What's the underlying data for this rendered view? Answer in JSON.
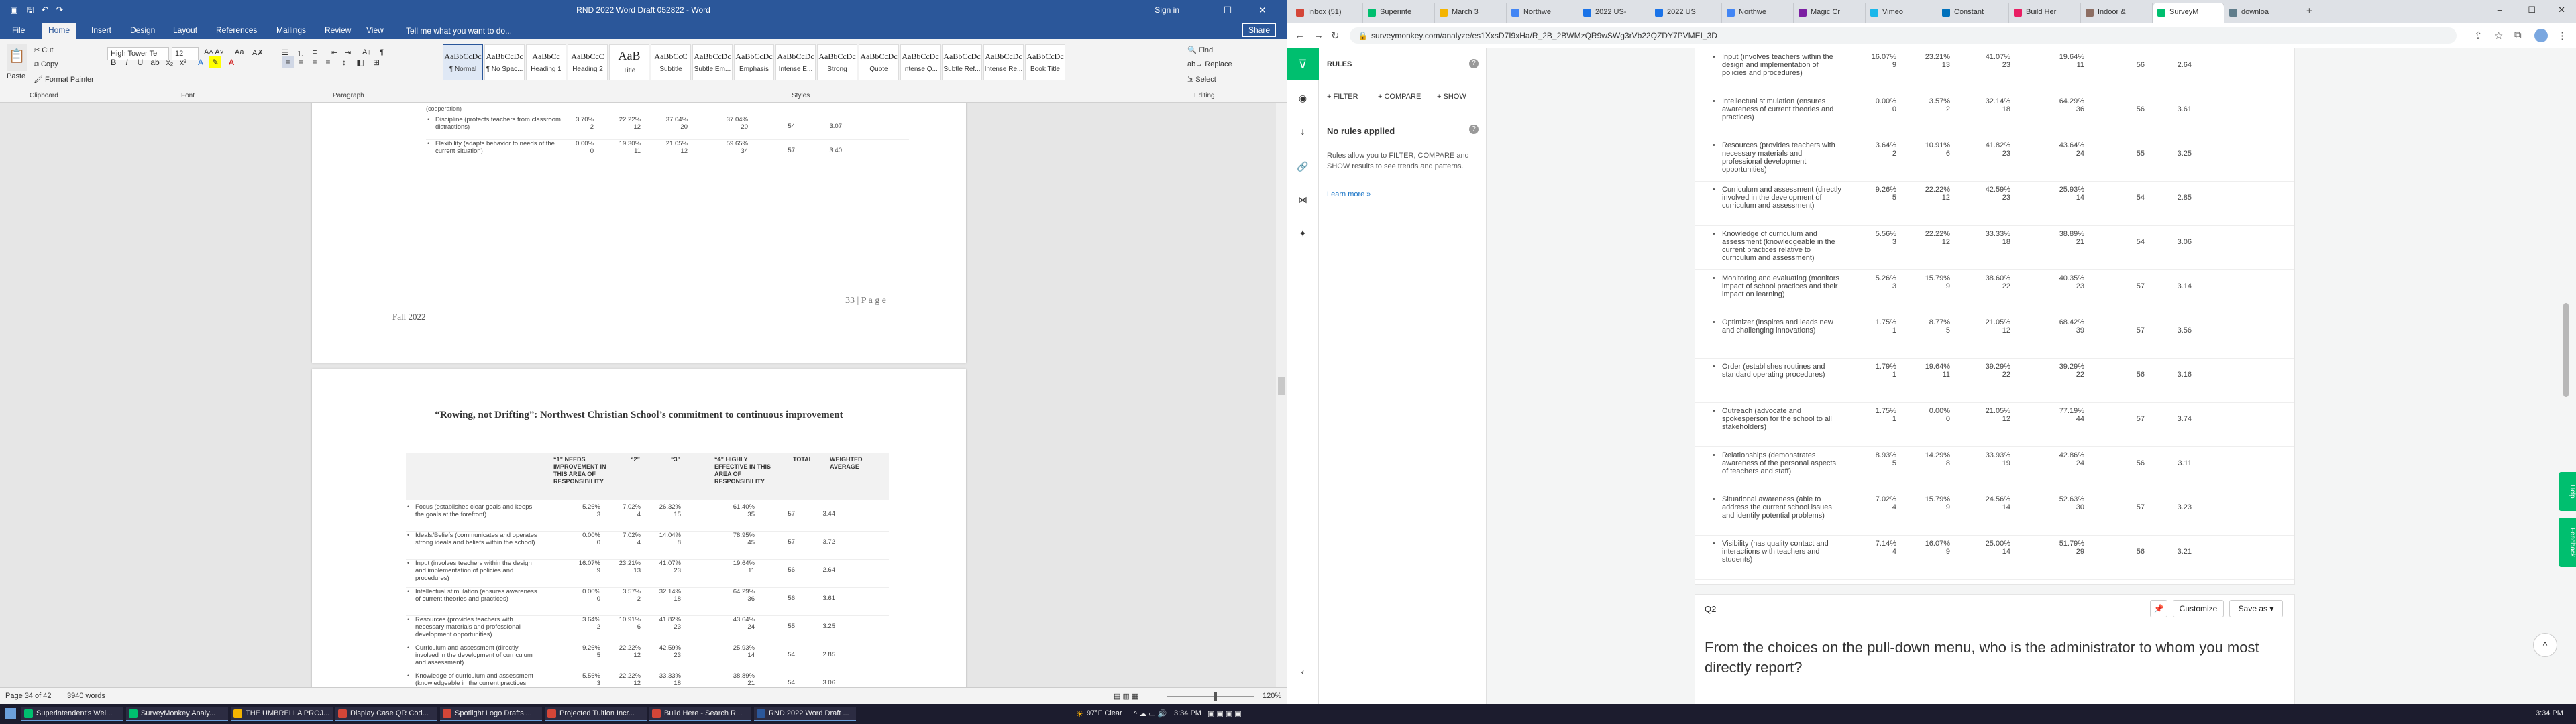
{
  "word": {
    "window_title": "RND 2022 Word Draft 052822 - Word",
    "signin": "Sign in",
    "share": "Share",
    "tabs": [
      "File",
      "Home",
      "Insert",
      "Design",
      "Layout",
      "References",
      "Mailings",
      "Review",
      "View"
    ],
    "tell_me": "Tell me what you want to do...",
    "clipboard": {
      "paste": "Paste",
      "cut": "Cut",
      "copy": "Copy",
      "format_painter": "Format Painter",
      "label": "Clipboard"
    },
    "font": {
      "name": "High Tower Te",
      "size": "12",
      "label": "Font"
    },
    "paragraph_label": "Paragraph",
    "styles_label": "Styles",
    "editing": {
      "find": "Find",
      "replace": "Replace",
      "select": "Select",
      "label": "Editing"
    },
    "styles": [
      {
        "preview": "AaBbCcDc",
        "name": "¶ Normal"
      },
      {
        "preview": "AaBbCcDc",
        "name": "¶ No Spac..."
      },
      {
        "preview": "AaBbCc",
        "name": "Heading 1"
      },
      {
        "preview": "AaBbCcC",
        "name": "Heading 2"
      },
      {
        "preview": "AaB",
        "name": "Title"
      },
      {
        "preview": "AaBbCcC",
        "name": "Subtitle"
      },
      {
        "preview": "AaBbCcDc",
        "name": "Subtle Em..."
      },
      {
        "preview": "AaBbCcDc",
        "name": "Emphasis"
      },
      {
        "preview": "AaBbCcDc",
        "name": "Intense E..."
      },
      {
        "preview": "AaBbCcDc",
        "name": "Strong"
      },
      {
        "preview": "AaBbCcDc",
        "name": "Quote"
      },
      {
        "preview": "AaBbCcDc",
        "name": "Intense Q..."
      },
      {
        "preview": "AaBbCcDc",
        "name": "Subtle Ref..."
      },
      {
        "preview": "AaBbCcDc",
        "name": "Intense Re..."
      },
      {
        "preview": "AaBbCcDc",
        "name": "Book Title"
      }
    ],
    "page1": {
      "top_fragment": "(cooperation)",
      "rows": [
        {
          "label": "Discipline (protects teachers from classroom distractions)",
          "v1": [
            "3.70%",
            "2"
          ],
          "v2": [
            "22.22%",
            "12"
          ],
          "v3": [
            "37.04%",
            "20"
          ],
          "v4": [
            "37.04%",
            "20"
          ],
          "total": "54",
          "avg": "3.07"
        },
        {
          "label": "Flexibility (adapts behavior to needs of the current situation)",
          "v1": [
            "0.00%",
            "0"
          ],
          "v2": [
            "19.30%",
            "11"
          ],
          "v3": [
            "21.05%",
            "12"
          ],
          "v4": [
            "59.65%",
            "34"
          ],
          "total": "57",
          "avg": "3.40"
        }
      ],
      "page_number": "33 | P a g e",
      "footer": "Fall 2022"
    },
    "page2": {
      "title": "“Rowing, not Drifting”: Northwest Christian School’s commitment to continuous improvement",
      "headers": {
        "c1": "“1” NEEDS IMPROVEMENT IN THIS AREA OF RESPONSIBILITY",
        "c2": "“2”",
        "c3": "“3”",
        "c4": "“4” HIGHLY EFFECTIVE IN THIS AREA OF RESPONSIBILITY",
        "total": "TOTAL",
        "avg": "WEIGHTED AVERAGE"
      },
      "rows": [
        {
          "label": "Focus (establishes clear goals and keeps the goals at the forefront)",
          "v1": [
            "5.26%",
            "3"
          ],
          "v2": [
            "7.02%",
            "4"
          ],
          "v3": [
            "26.32%",
            "15"
          ],
          "v4": [
            "61.40%",
            "35"
          ],
          "total": "57",
          "avg": "3.44"
        },
        {
          "label": "Ideals/Beliefs (communicates and operates strong ideals and beliefs within the school)",
          "v1": [
            "0.00%",
            "0"
          ],
          "v2": [
            "7.02%",
            "4"
          ],
          "v3": [
            "14.04%",
            "8"
          ],
          "v4": [
            "78.95%",
            "45"
          ],
          "total": "57",
          "avg": "3.72"
        },
        {
          "label": "Input (involves teachers within the design and implementation of policies and procedures)",
          "v1": [
            "16.07%",
            "9"
          ],
          "v2": [
            "23.21%",
            "13"
          ],
          "v3": [
            "41.07%",
            "23"
          ],
          "v4": [
            "19.64%",
            "11"
          ],
          "total": "56",
          "avg": "2.64"
        },
        {
          "label": "Intellectual stimulation (ensures awareness of current theories and practices)",
          "v1": [
            "0.00%",
            "0"
          ],
          "v2": [
            "3.57%",
            "2"
          ],
          "v3": [
            "32.14%",
            "18"
          ],
          "v4": [
            "64.29%",
            "36"
          ],
          "total": "56",
          "avg": "3.61"
        },
        {
          "label": "Resources (provides teachers with necessary materials and professional development opportunities)",
          "v1": [
            "3.64%",
            "2"
          ],
          "v2": [
            "10.91%",
            "6"
          ],
          "v3": [
            "41.82%",
            "23"
          ],
          "v4": [
            "43.64%",
            "24"
          ],
          "total": "55",
          "avg": "3.25"
        },
        {
          "label": "Curriculum and assessment (directly involved in the development of curriculum and assessment)",
          "v1": [
            "9.26%",
            "5"
          ],
          "v2": [
            "22.22%",
            "12"
          ],
          "v3": [
            "42.59%",
            "23"
          ],
          "v4": [
            "25.93%",
            "14"
          ],
          "total": "54",
          "avg": "2.85"
        },
        {
          "label": "Knowledge of curriculum and assessment (knowledgeable in the current practices relative to curriculum and assessment)",
          "v1": [
            "5.56%",
            "3"
          ],
          "v2": [
            "22.22%",
            "12"
          ],
          "v3": [
            "33.33%",
            "18"
          ],
          "v4": [
            "38.89%",
            "21"
          ],
          "total": "54",
          "avg": "3.06"
        }
      ]
    },
    "status": {
      "page": "Page 34 of 42",
      "words": "3940 words",
      "zoom": "120%"
    }
  },
  "browser": {
    "tabs": [
      {
        "label": "Inbox (51)",
        "color": "#d44638"
      },
      {
        "label": "Superinte",
        "color": "#00bf6f"
      },
      {
        "label": "March 3",
        "color": "#f4b400"
      },
      {
        "label": "Northwe",
        "color": "#4285f4"
      },
      {
        "label": "2022 US-",
        "color": "#1a73e8"
      },
      {
        "label": "2022 US",
        "color": "#1a73e8"
      },
      {
        "label": "Northwe",
        "color": "#4285f4"
      },
      {
        "label": "Magic Cr",
        "color": "#7b1fa2"
      },
      {
        "label": "Vimeo",
        "color": "#1ab7ea"
      },
      {
        "label": "Constant",
        "color": "#0071bc"
      },
      {
        "label": "Build Her",
        "color": "#e91e63"
      },
      {
        "label": "Indoor &",
        "color": "#8d6e63"
      },
      {
        "label": "SurveyM",
        "color": "#00bf6f"
      },
      {
        "label": "downloa",
        "color": "#607d8b"
      }
    ],
    "url": "surveymonkey.com/analyze/es1XxsD7I9xHa/R_2B_2BWMzQR9wSWg3rVb22QZDY7PVMEI_3D"
  },
  "survey": {
    "rules_title": "RULES",
    "filter": "+ FILTER",
    "compare": "+ COMPARE",
    "show": "+ SHOW",
    "no_rules": "No rules applied",
    "rules_desc": "Rules allow you to FILTER, COMPARE and SHOW results to see trends and patterns.",
    "learn_more": "Learn more »",
    "rows": [
      {
        "label": "Input (involves teachers within the design and implementation of policies and procedures)",
        "v1": [
          "16.07%",
          "9"
        ],
        "v2": [
          "23.21%",
          "13"
        ],
        "v3": [
          "41.07%",
          "23"
        ],
        "v4": [
          "19.64%",
          "11"
        ],
        "total": "56",
        "avg": "2.64"
      },
      {
        "label": "Intellectual stimulation (ensures awareness of current theories and practices)",
        "v1": [
          "0.00%",
          "0"
        ],
        "v2": [
          "3.57%",
          "2"
        ],
        "v3": [
          "32.14%",
          "18"
        ],
        "v4": [
          "64.29%",
          "36"
        ],
        "total": "56",
        "avg": "3.61"
      },
      {
        "label": "Resources (provides teachers with necessary materials and professional development opportunities)",
        "v1": [
          "3.64%",
          "2"
        ],
        "v2": [
          "10.91%",
          "6"
        ],
        "v3": [
          "41.82%",
          "23"
        ],
        "v4": [
          "43.64%",
          "24"
        ],
        "total": "55",
        "avg": "3.25"
      },
      {
        "label": "Curriculum and assessment (directly involved in the development of curriculum and assessment)",
        "v1": [
          "9.26%",
          "5"
        ],
        "v2": [
          "22.22%",
          "12"
        ],
        "v3": [
          "42.59%",
          "23"
        ],
        "v4": [
          "25.93%",
          "14"
        ],
        "total": "54",
        "avg": "2.85"
      },
      {
        "label": "Knowledge of curriculum and assessment (knowledgeable in the current practices relative to curriculum and assessment)",
        "v1": [
          "5.56%",
          "3"
        ],
        "v2": [
          "22.22%",
          "12"
        ],
        "v3": [
          "33.33%",
          "18"
        ],
        "v4": [
          "38.89%",
          "21"
        ],
        "total": "54",
        "avg": "3.06"
      },
      {
        "label": "Monitoring and evaluating (monitors impact of school practices and their impact on learning)",
        "v1": [
          "5.26%",
          "3"
        ],
        "v2": [
          "15.79%",
          "9"
        ],
        "v3": [
          "38.60%",
          "22"
        ],
        "v4": [
          "40.35%",
          "23"
        ],
        "total": "57",
        "avg": "3.14"
      },
      {
        "label": "Optimizer (inspires and leads new and challenging innovations)",
        "v1": [
          "1.75%",
          "1"
        ],
        "v2": [
          "8.77%",
          "5"
        ],
        "v3": [
          "21.05%",
          "12"
        ],
        "v4": [
          "68.42%",
          "39"
        ],
        "total": "57",
        "avg": "3.56"
      },
      {
        "label": "Order (establishes routines and standard operating procedures)",
        "v1": [
          "1.79%",
          "1"
        ],
        "v2": [
          "19.64%",
          "11"
        ],
        "v3": [
          "39.29%",
          "22"
        ],
        "v4": [
          "39.29%",
          "22"
        ],
        "total": "56",
        "avg": "3.16"
      },
      {
        "label": "Outreach (advocate and spokesperson for the school to all stakeholders)",
        "v1": [
          "1.75%",
          "1"
        ],
        "v2": [
          "0.00%",
          "0"
        ],
        "v3": [
          "21.05%",
          "12"
        ],
        "v4": [
          "77.19%",
          "44"
        ],
        "total": "57",
        "avg": "3.74"
      },
      {
        "label": "Relationships (demonstrates awareness of the personal aspects of teachers and staff)",
        "v1": [
          "8.93%",
          "5"
        ],
        "v2": [
          "14.29%",
          "8"
        ],
        "v3": [
          "33.93%",
          "19"
        ],
        "v4": [
          "42.86%",
          "24"
        ],
        "total": "56",
        "avg": "3.11"
      },
      {
        "label": "Situational awareness (able to address the current school issues and identify potential problems)",
        "v1": [
          "7.02%",
          "4"
        ],
        "v2": [
          "15.79%",
          "9"
        ],
        "v3": [
          "24.56%",
          "14"
        ],
        "v4": [
          "52.63%",
          "30"
        ],
        "total": "57",
        "avg": "3.23"
      },
      {
        "label": "Visibility (has quality contact and interactions with teachers and students)",
        "v1": [
          "7.14%",
          "4"
        ],
        "v2": [
          "16.07%",
          "9"
        ],
        "v3": [
          "25.00%",
          "14"
        ],
        "v4": [
          "51.79%",
          "29"
        ],
        "total": "56",
        "avg": "3.21"
      }
    ],
    "q2": {
      "label": "Q2",
      "customize": "Customize",
      "save_as": "Save as",
      "question": "From the choices on the pull-down menu, who is the administrator to whom you most directly report?"
    },
    "side_tabs": [
      "Help",
      "Feedback"
    ]
  },
  "taskbar": {
    "items": [
      {
        "label": "Superintendent's Wel...",
        "color": "#00bf6f"
      },
      {
        "label": "SurveyMonkey Analy...",
        "color": "#00bf6f"
      },
      {
        "label": "THE UMBRELLA PROJ...",
        "color": "#f4b400"
      },
      {
        "label": "Display Case QR Cod...",
        "color": "#d44638"
      },
      {
        "label": "Spotlight Logo Drafts ...",
        "color": "#d44638"
      },
      {
        "label": "Projected Tuition Incr...",
        "color": "#d44638"
      },
      {
        "label": "Build Here - Search R...",
        "color": "#d44638"
      },
      {
        "label": "RND 2022 Word Draft ...",
        "color": "#2b579a"
      }
    ],
    "weather": "97°F Clear",
    "time": "3:34 PM",
    "time2": "3:34 PM"
  }
}
